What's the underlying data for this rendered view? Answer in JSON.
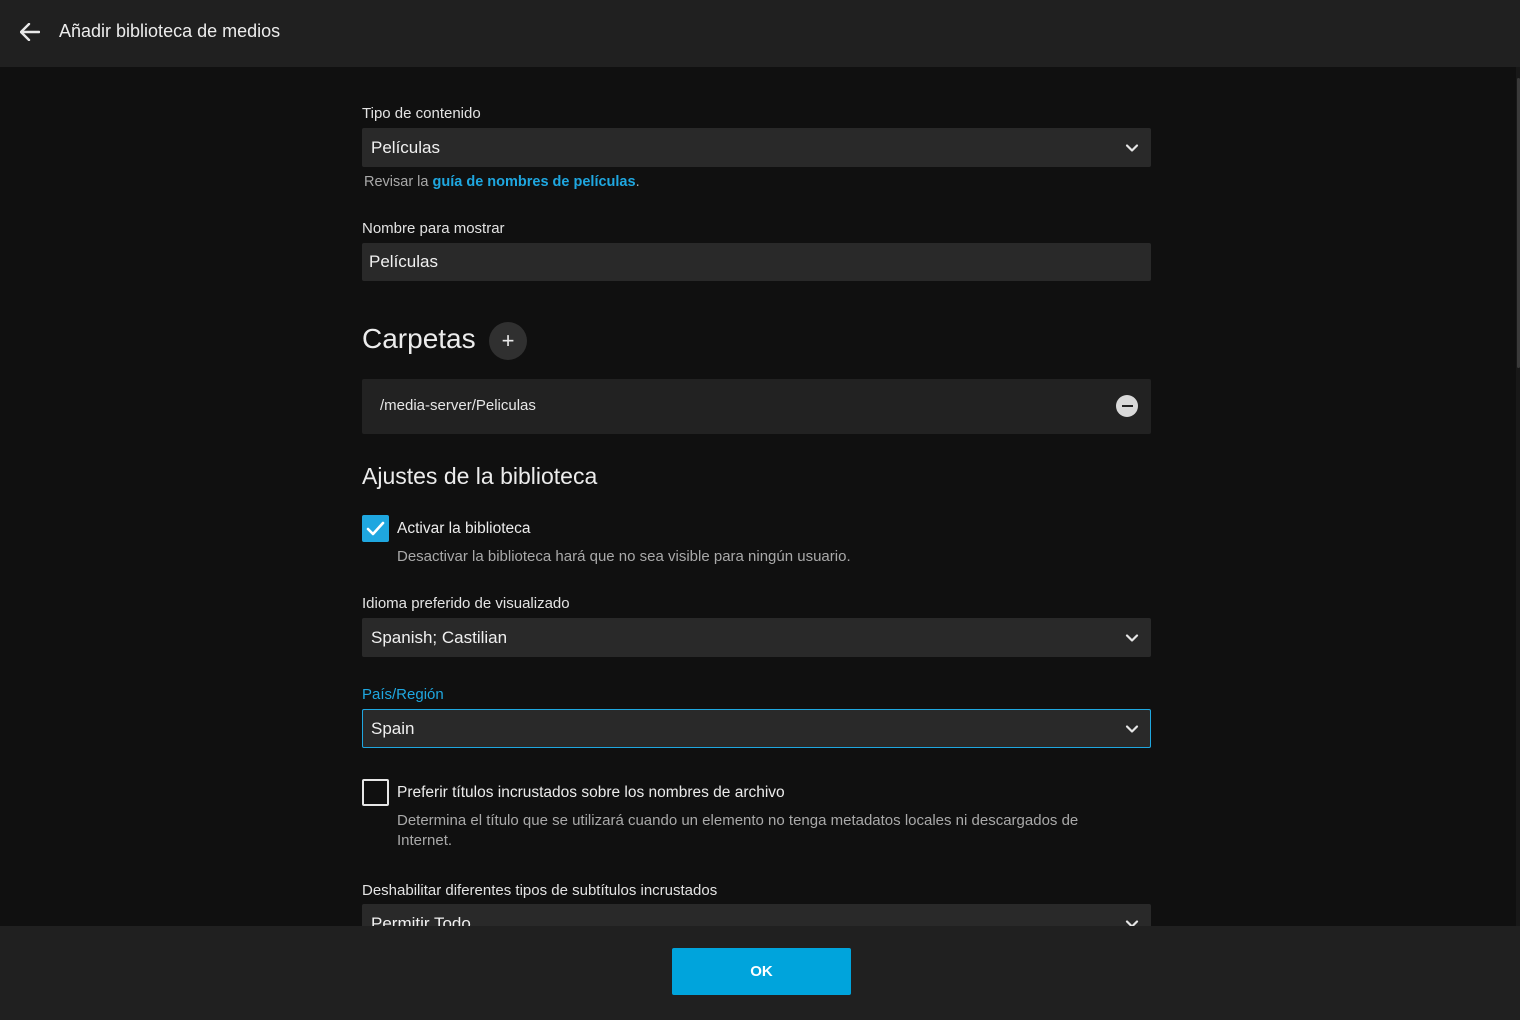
{
  "header": {
    "back_icon": "arrow-left-icon",
    "title": "Añadir biblioteca de medios"
  },
  "content_type": {
    "label": "Tipo de contenido",
    "value": "Películas",
    "help_prefix": "Revisar la ",
    "help_link": "guía de nombres de películas",
    "help_suffix": "."
  },
  "display_name": {
    "label": "Nombre para mostrar",
    "value": "Películas"
  },
  "folders": {
    "title": "Carpetas",
    "add_icon": "plus-icon",
    "items": [
      {
        "path": "/media-server/Peliculas",
        "remove_icon": "minus-circle-icon"
      }
    ]
  },
  "library_settings": {
    "title": "Ajustes de la biblioteca",
    "enable_library": {
      "label": "Activar la biblioteca",
      "description": "Desactivar la biblioteca hará que no sea visible para ningún usuario.",
      "checked": true
    },
    "preferred_language": {
      "label": "Idioma preferido de visualizado",
      "value": "Spanish; Castilian"
    },
    "country": {
      "label": "País/Región",
      "value": "Spain",
      "focused": true
    },
    "prefer_embedded_titles": {
      "label": "Preferir títulos incrustados sobre los nombres de archivo",
      "description": "Determina el título que se utilizará cuando un elemento no tenga metadatos locales ni descargados de Internet.",
      "checked": false
    },
    "disable_subtitles": {
      "label": "Deshabilitar diferentes tipos de subtítulos incrustados",
      "value": "Permitir Todo"
    }
  },
  "footer": {
    "ok_label": "OK"
  },
  "colors": {
    "accent": "#00a4dc",
    "background": "#101010",
    "header": "#202020",
    "field": "#292929"
  }
}
